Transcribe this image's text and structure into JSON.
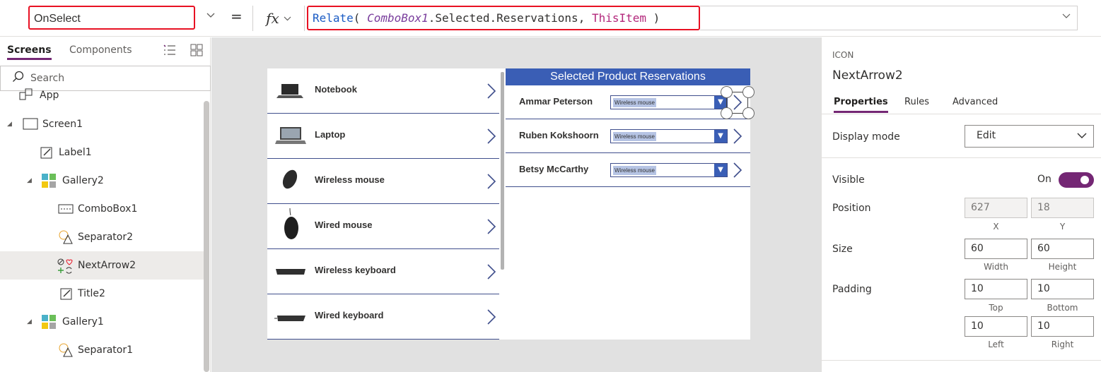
{
  "formula_bar": {
    "property": "OnSelect",
    "fx_label": "fx",
    "fx_dropdown": "⌵",
    "formula_fn": "Relate",
    "formula_open": "( ",
    "formula_arg1": "ComboBox1",
    "formula_mid": ".Selected.Reservations, ",
    "formula_arg2": "ThisItem",
    "formula_close": " )",
    "equals": "="
  },
  "left_pane": {
    "tabs": [
      "Screens",
      "Components"
    ],
    "search_placeholder": "Search",
    "tree": [
      {
        "label": "App",
        "icon": "app-icon"
      },
      {
        "label": "Screen1",
        "icon": "screen-icon"
      },
      {
        "label": "Label1",
        "icon": "label-icon"
      },
      {
        "label": "Gallery2",
        "icon": "gallery-icon"
      },
      {
        "label": "ComboBox1",
        "icon": "combobox-icon"
      },
      {
        "label": "Separator2",
        "icon": "shapes-icon"
      },
      {
        "label": "NextArrow2",
        "icon": "icons-icon"
      },
      {
        "label": "Title2",
        "icon": "label-icon"
      },
      {
        "label": "Gallery1",
        "icon": "gallery-icon"
      },
      {
        "label": "Separator1",
        "icon": "shapes-icon"
      }
    ]
  },
  "canvas": {
    "products": [
      "Notebook",
      "Laptop",
      "Wireless mouse",
      "Wired mouse",
      "Wireless keyboard",
      "Wired keyboard"
    ],
    "reservations_title": "Selected Product Reservations",
    "reservations": [
      {
        "name": "Ammar Peterson",
        "product": "Wireless mouse"
      },
      {
        "name": "Ruben Kokshoorn",
        "product": "Wireless mouse"
      },
      {
        "name": "Betsy McCarthy",
        "product": "Wireless mouse"
      }
    ]
  },
  "right_pane": {
    "kind": "ICON",
    "name": "NextArrow2",
    "tabs": [
      "Properties",
      "Rules",
      "Advanced"
    ],
    "display_mode_label": "Display mode",
    "display_mode_value": "Edit",
    "visible_label": "Visible",
    "visible_value": "On",
    "position_label": "Position",
    "position_x": "627",
    "position_y": "18",
    "x_caption": "X",
    "y_caption": "Y",
    "size_label": "Size",
    "width": "60",
    "height": "60",
    "width_caption": "Width",
    "height_caption": "Height",
    "padding_label": "Padding",
    "pad_top": "10",
    "pad_bottom": "10",
    "pad_left": "10",
    "pad_right": "10",
    "top_caption": "Top",
    "bottom_caption": "Bottom",
    "left_caption": "Left",
    "right_caption": "Right"
  },
  "colors": {
    "accent": "#742774",
    "gallery_header": "#3a5eb5",
    "error_outline": "#e81123"
  }
}
